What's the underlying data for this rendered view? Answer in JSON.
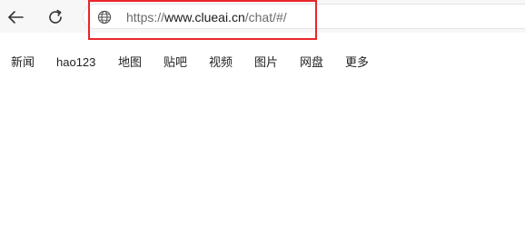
{
  "toolbar": {
    "back_icon": "back-arrow-icon",
    "reload_icon": "reload-icon"
  },
  "address_bar": {
    "site_icon": "globe-icon",
    "url_scheme": "https://",
    "url_host": "www.clueai.cn",
    "url_path": "/chat/#/"
  },
  "annotation": {
    "highlight_color": "#e8262b"
  },
  "nav_links": [
    {
      "label": "新闻"
    },
    {
      "label": "hao123"
    },
    {
      "label": "地图"
    },
    {
      "label": "贴吧"
    },
    {
      "label": "视频"
    },
    {
      "label": "图片"
    },
    {
      "label": "网盘"
    },
    {
      "label": "更多"
    }
  ]
}
